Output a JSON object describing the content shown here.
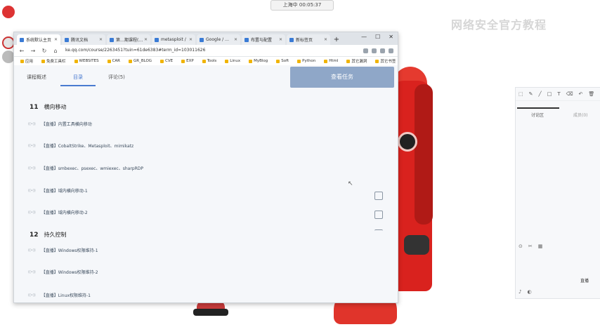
{
  "desktop": {
    "recording_label": "上海中 00:05:37",
    "watermark": "网络安全官方教程"
  },
  "browser": {
    "tabs": [
      {
        "label": "系统默认主页",
        "active": true
      },
      {
        "label": "腾讯文档",
        "active": false
      },
      {
        "label": "第…期课程(…)",
        "active": false
      },
      {
        "label": "metasploit / …",
        "active": false
      },
      {
        "label": "Google / …",
        "active": false
      },
      {
        "label": "布置与配置",
        "active": false
      },
      {
        "label": "新标签页",
        "active": false
      }
    ],
    "window_controls": [
      "—",
      "☐",
      "✕"
    ],
    "url": "ke.qq.com/course/2263451?tuin=61de6383#term_id=103011626",
    "bookmarks": [
      "应用",
      "免费工具栏",
      "WEBSITES",
      "CAR",
      "GR_BLOG",
      "CVE",
      "EXP",
      "Tools",
      "Linux",
      "MyBlog",
      "Soft",
      "Python",
      "Html",
      "其它漏洞",
      "其它书签"
    ]
  },
  "course": {
    "tabs": [
      "课程概述",
      "目录",
      "评论(5)"
    ],
    "active_tab": "目录",
    "cta_button": "查看任务",
    "chapters": [
      {
        "number": "11",
        "title": "横向移动",
        "lessons": [
          "【直播】内置工具横向移动",
          "【直播】CobaltStrike、Metasploit、mimikatz",
          "【直播】smbexec、psexec、wmiexec、sharpRDP",
          "【直播】域内横向移动-1",
          "【直播】域内横向移动-2"
        ]
      },
      {
        "number": "12",
        "title": "持久控制",
        "lessons": [
          "【直播】Windows权限维持-1",
          "【直播】Windows权限维持-2",
          "【直播】Linux权限维持-1"
        ]
      }
    ]
  },
  "tool_panel": {
    "tabs": [
      "讨论区",
      "成员(0)"
    ],
    "bottom_label": "直播"
  }
}
